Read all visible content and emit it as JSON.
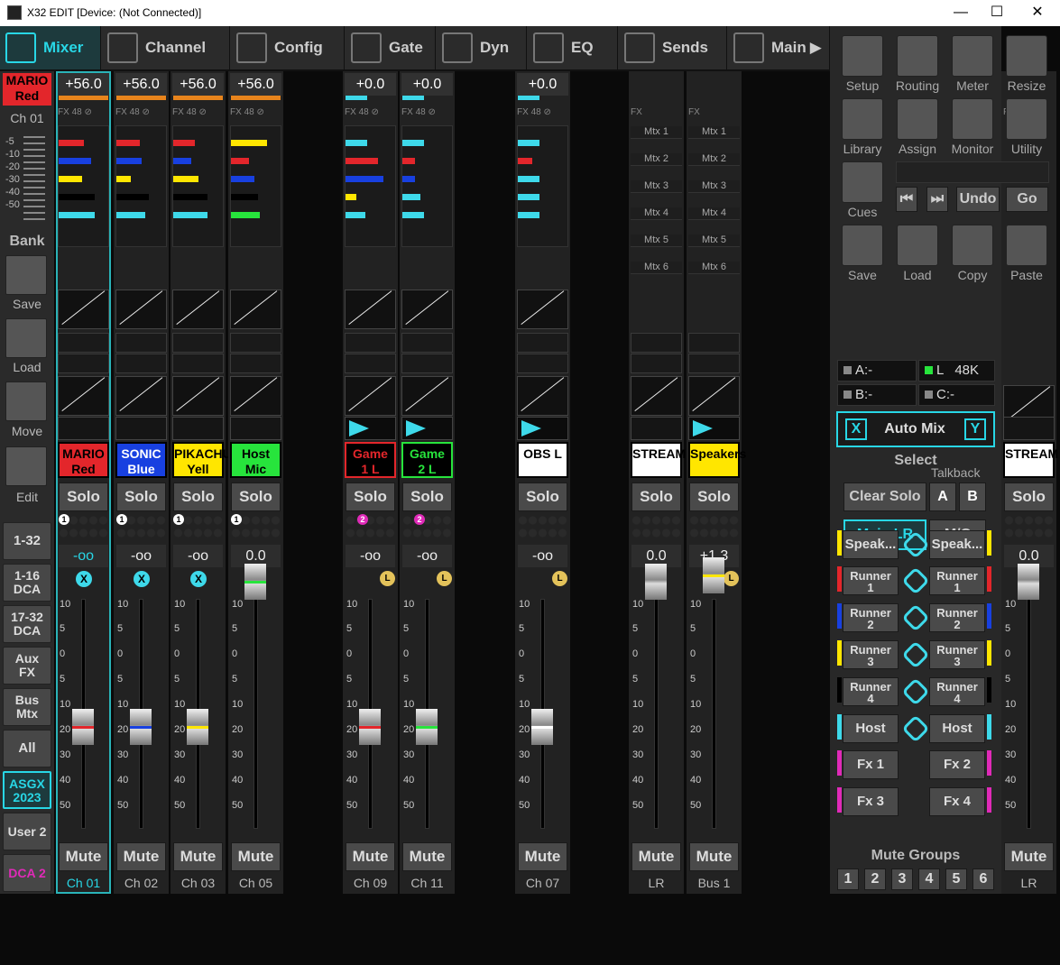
{
  "window": {
    "title": "X32 EDIT [Device: (Not Connected)]",
    "min": "—",
    "max": "☐",
    "close": "✕"
  },
  "tabs": [
    {
      "label": "Mixer"
    },
    {
      "label": "Channel"
    },
    {
      "label": "Config"
    },
    {
      "label": "Gate"
    },
    {
      "label": "Dyn"
    },
    {
      "label": "EQ"
    },
    {
      "label": "Sends"
    },
    {
      "label": "Main"
    }
  ],
  "left": {
    "sel_name": "MARIO",
    "sel_color": "Red",
    "sel_ch": "Ch 01",
    "meter_ticks": [
      "-5",
      "-10",
      "-20",
      "-30",
      "-40",
      "-50"
    ],
    "bank": "Bank",
    "save": "Save",
    "load": "Load",
    "move": "Move",
    "edit": "Edit",
    "b1": "1-32",
    "b2a": "1-16",
    "b2b": "DCA",
    "b3a": "17-32",
    "b3b": "DCA",
    "b4a": "Aux",
    "b4b": "FX",
    "b5a": "Bus",
    "b5b": "Mtx",
    "b6": "All",
    "b7a": "ASGX",
    "b7b": "2023",
    "b8": "User 2",
    "b9": "DCA 2"
  },
  "strips": [
    {
      "gain": "+56.0",
      "name1": "MARIO",
      "name2": "Red",
      "solo": "Solo",
      "fader": "-oo",
      "mute": "Mute",
      "label": "Ch 01",
      "fx": "48"
    },
    {
      "gain": "+56.0",
      "name1": "SONIC",
      "name2": "Blue",
      "solo": "Solo",
      "fader": "-oo",
      "mute": "Mute",
      "label": "Ch 02",
      "fx": "48"
    },
    {
      "gain": "+56.0",
      "name1": "PIKACHU",
      "name2": "Yell",
      "solo": "Solo",
      "fader": "-oo",
      "mute": "Mute",
      "label": "Ch 03",
      "fx": "48"
    },
    {
      "gain": "+56.0",
      "name1": "Host Mic",
      "name2": "",
      "solo": "Solo",
      "fader": "0.0",
      "mute": "Mute",
      "label": "Ch 05",
      "fx": "48"
    },
    {
      "gain": "+0.0",
      "name1": "Game",
      "name2": "1 L",
      "solo": "Solo",
      "fader": "-oo",
      "mute": "Mute",
      "label": "Ch 09",
      "fx": "48"
    },
    {
      "gain": "+0.0",
      "name1": "Game",
      "name2": "2 L",
      "solo": "Solo",
      "fader": "-oo",
      "mute": "Mute",
      "label": "Ch 11",
      "fx": "48"
    },
    {
      "gain": "+0.0",
      "name1": "OBS L",
      "name2": "",
      "solo": "Solo",
      "fader": "-oo",
      "mute": "Mute",
      "label": "Ch 07",
      "fx": "48"
    },
    {
      "gain": "",
      "name1": "STREAM",
      "name2": "",
      "solo": "Solo",
      "fader": "0.0",
      "mute": "Mute",
      "label": "LR",
      "fx": ""
    },
    {
      "gain": "",
      "name1": "Speakers",
      "name2": "",
      "solo": "Solo",
      "fader": "+1.3",
      "mute": "Mute",
      "label": "Bus 1",
      "fx": ""
    },
    {
      "gain": "",
      "name1": "STREAM",
      "name2": "",
      "solo": "Solo",
      "fader": "0.0",
      "mute": "Mute",
      "label": "LR",
      "fx": ""
    }
  ],
  "fx_label": "FX",
  "fader_ticks": [
    "10",
    "5",
    "0",
    "5",
    "10",
    "20",
    "30",
    "40",
    "50"
  ],
  "matrix": [
    "Mtx 1",
    "Mtx 2",
    "Mtx 3",
    "Mtx 4",
    "Mtx 5",
    "Mtx 6"
  ],
  "x_mark": "X",
  "l_mark": "L",
  "bus_numbers": [
    "1",
    "2"
  ],
  "right": {
    "setup": "Setup",
    "routing": "Routing",
    "meter": "Meter",
    "resize": "Resize",
    "library": "Library",
    "assign": "Assign",
    "monitor": "Monitor",
    "utility": "Utility",
    "cues": "Cues",
    "undo": "Undo",
    "go": "Go",
    "save": "Save",
    "load": "Load",
    "copy": "Copy",
    "paste": "Paste",
    "a": "A:-",
    "l": "L",
    "rate": "48K",
    "b": "B:-",
    "c": "C:-",
    "x": "X",
    "automix": "Auto Mix",
    "y": "Y",
    "select": "Select",
    "talkback": "Talkback",
    "clearsolo": "Clear Solo",
    "ta": "A",
    "tb": "B",
    "mainlr": "Main LR",
    "mc": "M/C",
    "assign_left": [
      {
        "l1": "Speak...",
        "l2": ""
      },
      {
        "l1": "Runner",
        "l2": "1"
      },
      {
        "l1": "Runner",
        "l2": "2"
      },
      {
        "l1": "Runner",
        "l2": "3"
      },
      {
        "l1": "Runner",
        "l2": "4"
      },
      {
        "l1": "Host",
        "l2": ""
      },
      {
        "l1": "Fx 1",
        "l2": ""
      },
      {
        "l1": "Fx 3",
        "l2": ""
      }
    ],
    "assign_right": [
      {
        "l1": "Speak...",
        "l2": ""
      },
      {
        "l1": "Runner",
        "l2": "1"
      },
      {
        "l1": "Runner",
        "l2": "2"
      },
      {
        "l1": "Runner",
        "l2": "3"
      },
      {
        "l1": "Runner",
        "l2": "4"
      },
      {
        "l1": "Host",
        "l2": ""
      },
      {
        "l1": "Fx 2",
        "l2": ""
      },
      {
        "l1": "Fx 4",
        "l2": ""
      }
    ],
    "mutegroups": "Mute Groups",
    "mg": [
      "1",
      "2",
      "3",
      "4",
      "5",
      "6"
    ]
  },
  "colors": {
    "accent": "#28d7e6",
    "red": "#e3262b",
    "blue": "#1840e0",
    "yellow": "#ffe600",
    "green": "#27e43c",
    "white": "#ffffff",
    "magenta": "#e02ab8"
  }
}
